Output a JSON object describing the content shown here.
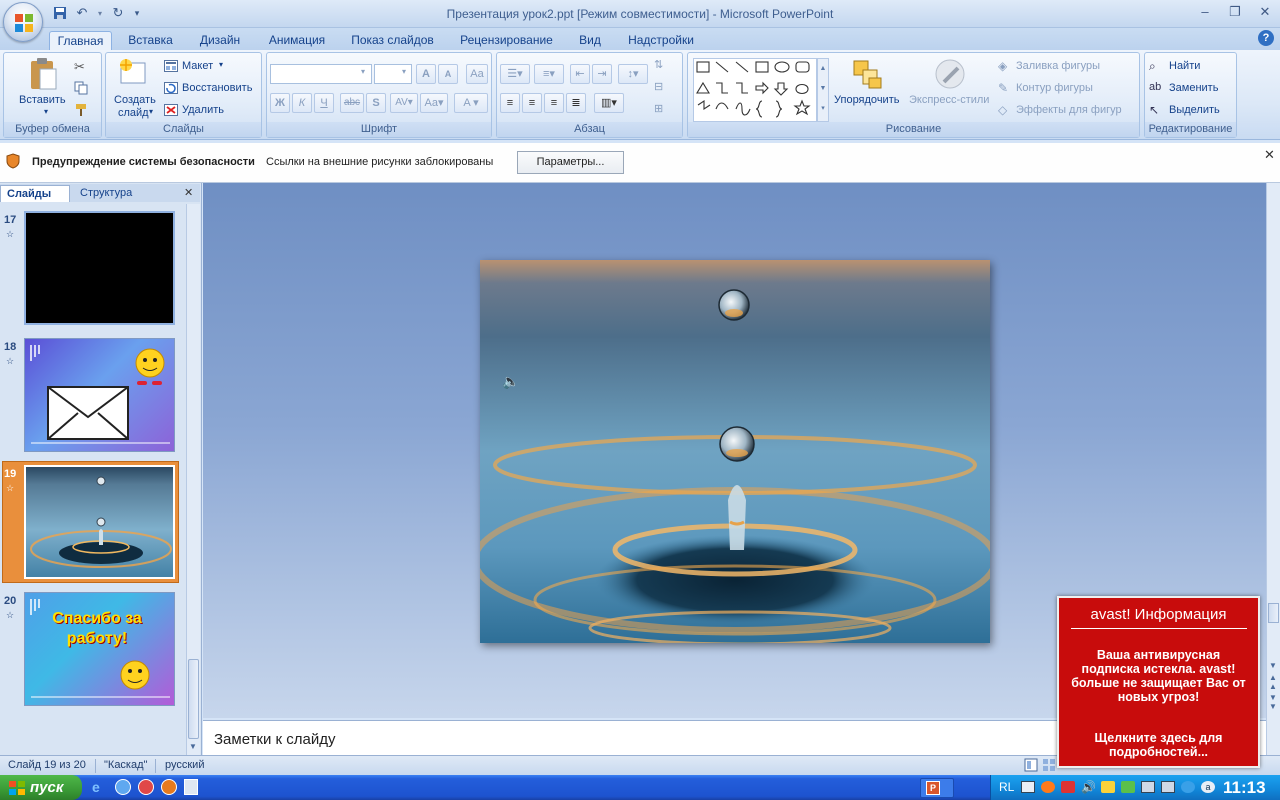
{
  "window": {
    "title": "Презентация урок2.ppt [Режим совместимости] - Microsoft PowerPoint"
  },
  "tabs": [
    {
      "label": "Главная",
      "active": true
    },
    {
      "label": "Вставка"
    },
    {
      "label": "Дизайн"
    },
    {
      "label": "Анимация"
    },
    {
      "label": "Показ слайдов"
    },
    {
      "label": "Рецензирование"
    },
    {
      "label": "Вид"
    },
    {
      "label": "Надстройки"
    }
  ],
  "ribbon": {
    "clipboard": {
      "label": "Буфер обмена",
      "paste": "Вставить"
    },
    "slides": {
      "label": "Слайды",
      "new_slide_1": "Создать",
      "new_slide_2": "слайд",
      "layout": "Макет",
      "reset": "Восстановить",
      "delete": "Удалить"
    },
    "font": {
      "label": "Шрифт"
    },
    "paragraph": {
      "label": "Абзац"
    },
    "drawing": {
      "label": "Рисование",
      "arrange": "Упорядочить",
      "quick_styles": "Экспресс-стили",
      "shape_fill": "Заливка фигуры",
      "shape_outline": "Контур фигуры",
      "shape_effects": "Эффекты для фигур"
    },
    "editing": {
      "label": "Редактирование",
      "find": "Найти",
      "replace": "Заменить",
      "select": "Выделить"
    }
  },
  "security_bar": {
    "title": "Предупреждение системы безопасности",
    "message": "Ссылки на внешние рисунки заблокированы",
    "button": "Параметры..."
  },
  "left_pane": {
    "tab_slides": "Слайды",
    "tab_outline": "Структура",
    "slides": [
      {
        "number": "17"
      },
      {
        "number": "18"
      },
      {
        "number": "19",
        "selected": true
      },
      {
        "number": "20",
        "text_line1": "Спасибо за",
        "text_line2": "работу!"
      }
    ]
  },
  "notes": {
    "placeholder": "Заметки к слайду"
  },
  "status": {
    "slide_info": "Слайд 19 из 20",
    "theme": "\"Каскад\"",
    "language": "русский"
  },
  "taskbar": {
    "start": "пуск",
    "lang": "RL",
    "clock": "11:13"
  },
  "avast_popup": {
    "title": "avast! Информация",
    "message": "Ваша антивирусная подписка истекла. avast! больше не защищает Вас от новых угроз!",
    "link": "Щелкните здесь для подробностей..."
  },
  "colors": {
    "ribbon_text": "#15428b",
    "avast_red": "#c80c0c",
    "taskbar_blue": "#245edb",
    "start_green": "#3a9a36"
  }
}
